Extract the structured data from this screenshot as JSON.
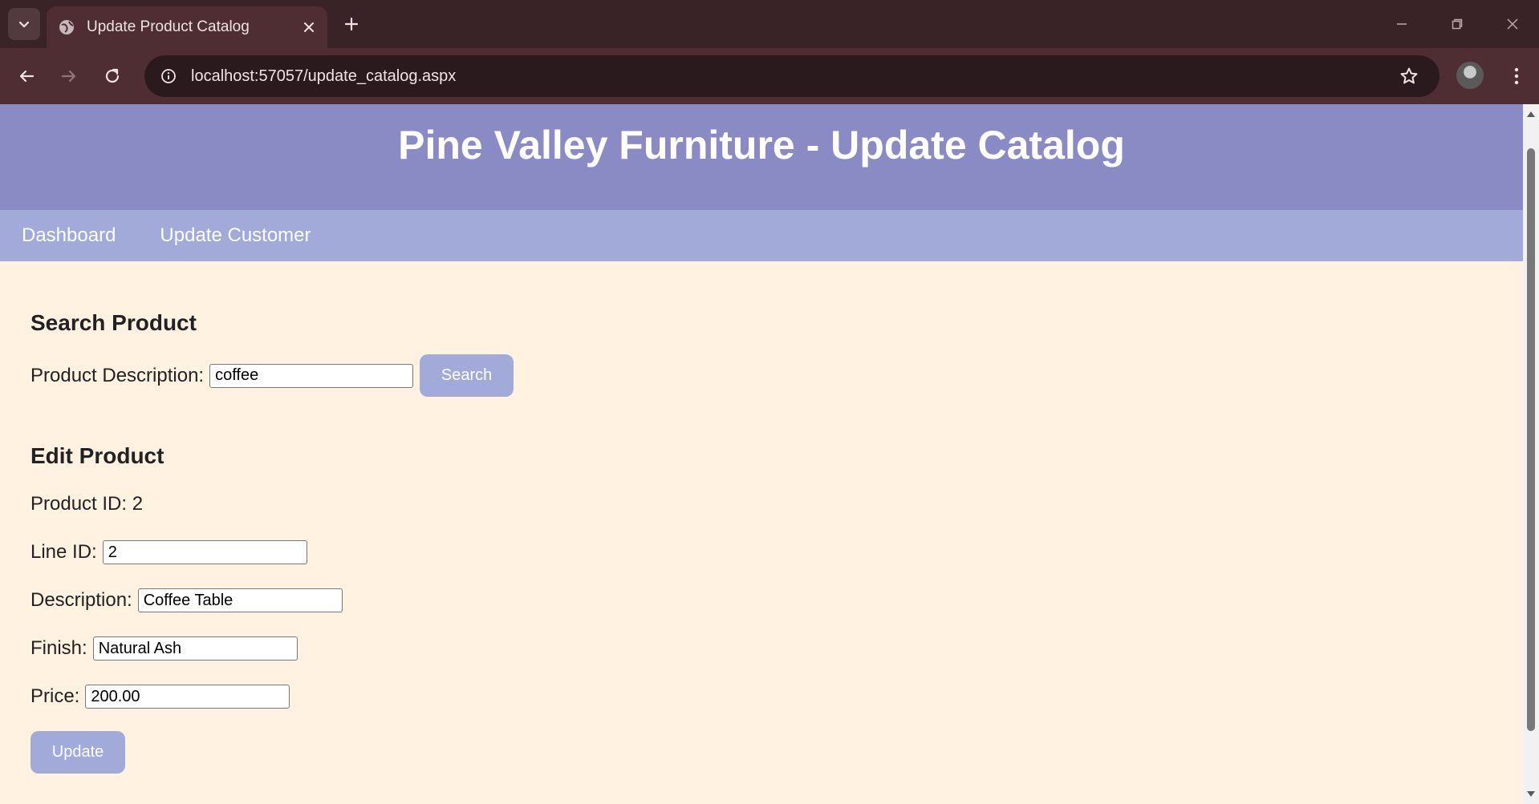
{
  "browser": {
    "tab_title": "Update Product Catalog",
    "url": "localhost:57057/update_catalog.aspx"
  },
  "page": {
    "title": "Pine Valley Furniture - Update Catalog",
    "nav": [
      {
        "label": "Dashboard"
      },
      {
        "label": "Update Customer"
      }
    ]
  },
  "search": {
    "heading": "Search Product",
    "label": "Product Description:",
    "value": "coffee",
    "button": "Search"
  },
  "edit": {
    "heading": "Edit Product",
    "product_id_text": "Product ID: 2",
    "line_id_label": "Line ID:",
    "line_id_value": "2",
    "description_label": "Description:",
    "description_value": "Coffee Table",
    "finish_label": "Finish:",
    "finish_value": "Natural Ash",
    "price_label": "Price:",
    "price_value": "200.00",
    "update_button": "Update"
  },
  "colors": {
    "header_bg": "#8a8ac4",
    "nav_bg": "#a1aad9",
    "page_bg": "#fff2e1",
    "button_bg": "#a1aad9",
    "chrome_dark": "#3a2327"
  }
}
